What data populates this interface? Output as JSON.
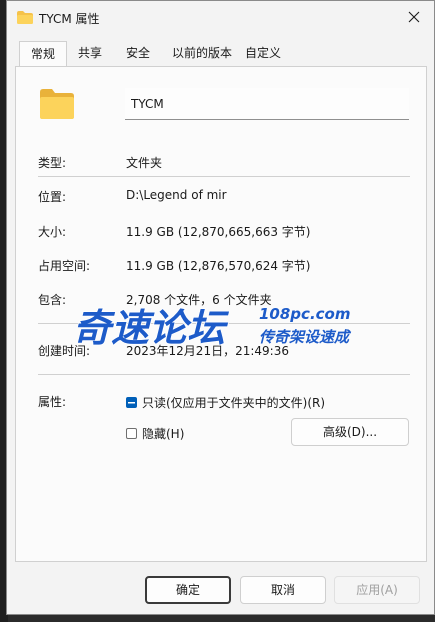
{
  "window": {
    "title": "TYCM 属性"
  },
  "tabs": [
    {
      "label": "常规",
      "active": true
    },
    {
      "label": "共享",
      "active": false
    },
    {
      "label": "安全",
      "active": false
    },
    {
      "label": "以前的版本",
      "active": false
    },
    {
      "label": "自定义",
      "active": false
    }
  ],
  "general": {
    "name": "TYCM",
    "rows": {
      "type": {
        "label": "类型:",
        "value": "文件夹"
      },
      "location": {
        "label": "位置:",
        "value": "D:\\Legend of mir"
      },
      "size": {
        "label": "大小:",
        "value": "11.9 GB (12,870,665,663 字节)"
      },
      "size_on_disk": {
        "label": "占用空间:",
        "value": "11.9 GB (12,876,570,624 字节)"
      },
      "contains": {
        "label": "包含:",
        "value": "2,708 个文件，6 个文件夹"
      },
      "created": {
        "label": "创建时间:",
        "value": "2023年12月21日，21:49:36"
      }
    },
    "attributes": {
      "label": "属性:",
      "readonly": {
        "label": "只读(仅应用于文件夹中的文件)(R)",
        "state": "indeterminate"
      },
      "hidden": {
        "label": "隐藏(H)",
        "checked": false
      },
      "advanced_label": "高级(D)..."
    }
  },
  "buttons": {
    "ok": "确定",
    "cancel": "取消",
    "apply": "应用(A)"
  },
  "watermark": {
    "main": "奇速论坛",
    "url": "108pc.com",
    "slogan": "传奇架设速成"
  },
  "colors": {
    "accent": "#005fb8",
    "folder": "#f5c24a",
    "watermark_blue": "#1d5bc9"
  },
  "icons": {
    "title": "folder-icon",
    "close": "close-icon",
    "large": "folder-icon"
  }
}
